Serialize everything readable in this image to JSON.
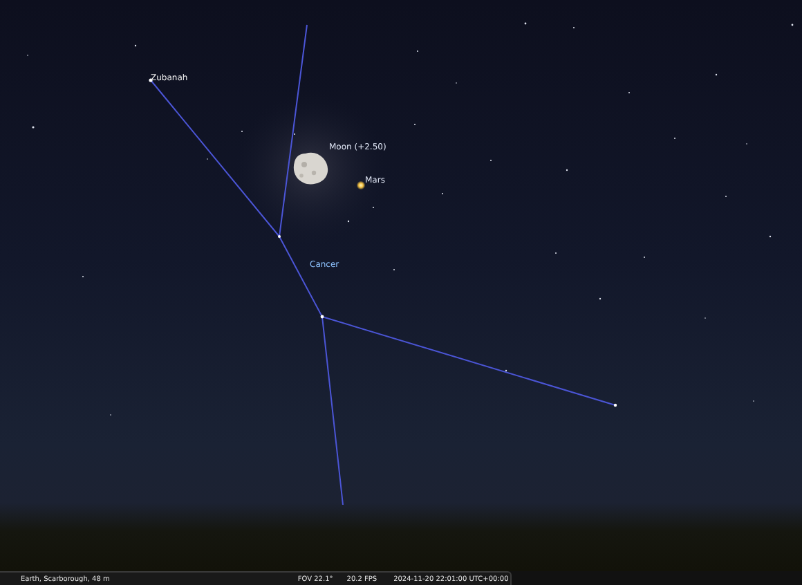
{
  "sky_labels": [
    {
      "text": "Zubanah",
      "kind": "star"
    },
    {
      "text": "Moon (+2.50)",
      "kind": "moon"
    },
    {
      "text": "Mars",
      "kind": "planet"
    },
    {
      "text": "Cancer",
      "kind": "constellation"
    }
  ],
  "status_bar": {
    "location": "Earth, Scarborough, 48 m",
    "fov": "FOV 22.1°",
    "fps": "20.2 FPS",
    "datetime": "2024-11-20 22:01:00 UTC+00:00"
  }
}
